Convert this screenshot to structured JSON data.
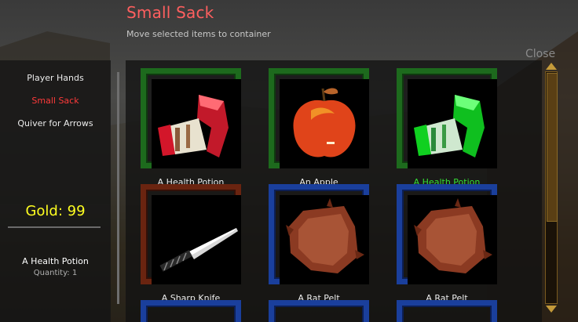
{
  "window": {
    "title": "Small Sack",
    "subtitle": "Move selected items to container",
    "close_label": "Close"
  },
  "sidebar": {
    "items": [
      {
        "label": "Player Hands",
        "active": false
      },
      {
        "label": "Small Sack",
        "active": true
      },
      {
        "label": "Quiver for Arrows",
        "active": false
      }
    ],
    "gold_label": "Gold: 99",
    "selected_item": {
      "name": "A Health Potion",
      "quantity_label": "Quantity: 1"
    }
  },
  "items": [
    {
      "label": "A Health Potion",
      "frame": "green",
      "icon": "health-potion-icon",
      "selected": false
    },
    {
      "label": "An Apple",
      "frame": "green",
      "icon": "apple-icon",
      "selected": false
    },
    {
      "label": "A Health Potion",
      "frame": "green",
      "icon": "health-potion-icon",
      "selected": true
    },
    {
      "label": "A Sharp Knife",
      "frame": "red",
      "icon": "knife-icon",
      "selected": false
    },
    {
      "label": "A Rat Pelt",
      "frame": "blue",
      "icon": "rat-pelt-icon",
      "selected": false
    },
    {
      "label": "A Rat Pelt",
      "frame": "blue",
      "icon": "rat-pelt-icon",
      "selected": false
    }
  ],
  "colors": {
    "title": "#ff5f5f",
    "active_menu": "#ff3a3a",
    "gold": "#ffff20",
    "selected_label": "#35e035",
    "frame_green": "#1d6a1d",
    "frame_blue": "#1a3f9c",
    "frame_red": "#6a2410"
  }
}
